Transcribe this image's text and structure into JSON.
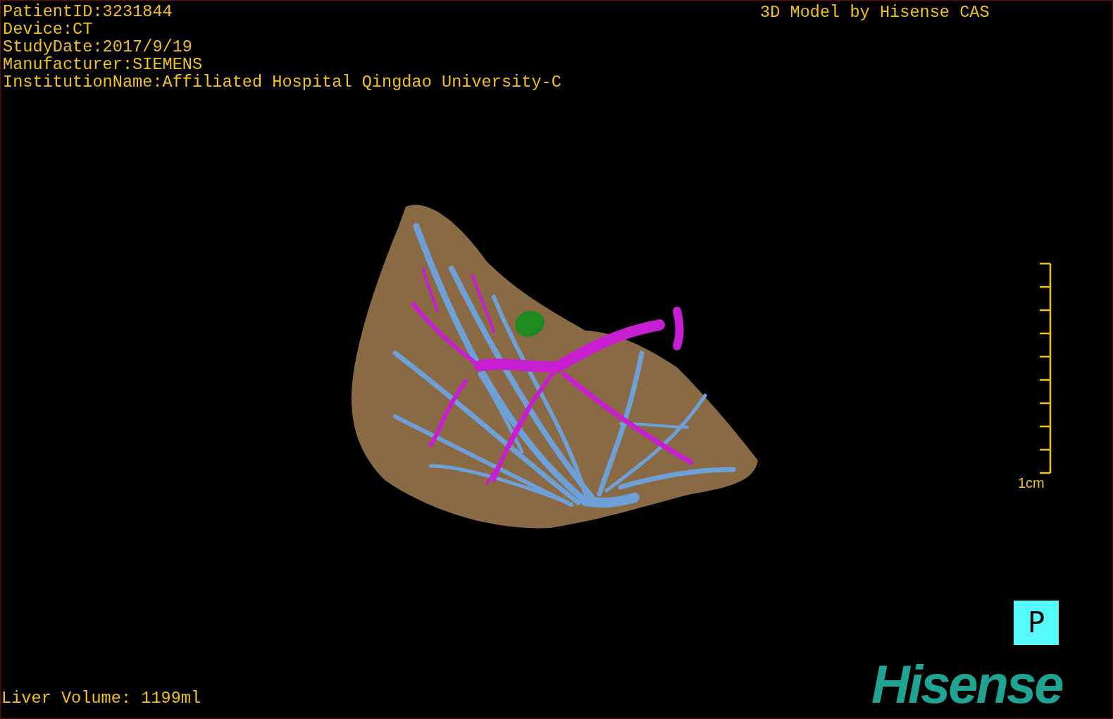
{
  "patient_info": [
    "PatientID:3231844",
    "Device:CT",
    "StudyDate:2017/9/19",
    "Manufacturer:SIEMENS",
    "InstitutionName:Affiliated Hospital Qingdao University-C"
  ],
  "title": "3D Model by Hisense CAS",
  "scale": {
    "label": "1cm"
  },
  "orientation": "P",
  "liver_volume": "Liver Volume: 1199ml",
  "logo": "Hisense"
}
